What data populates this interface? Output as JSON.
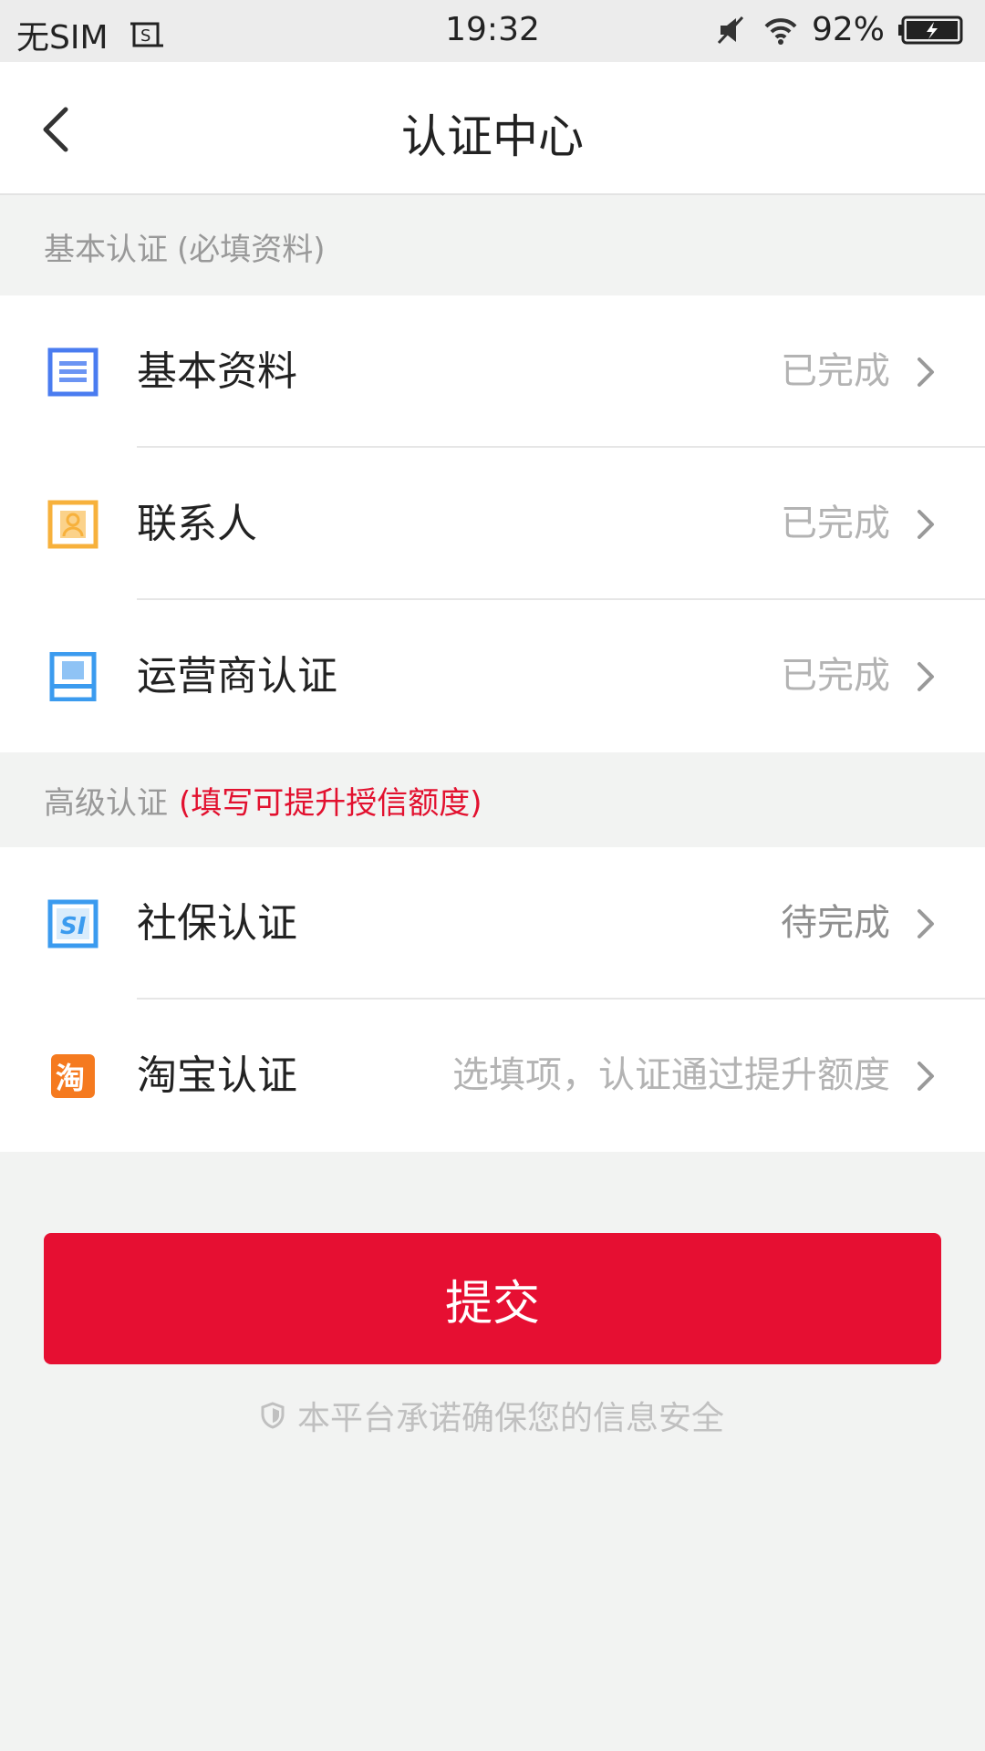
{
  "status_bar": {
    "carrier": "无SIM",
    "time": "19:32",
    "battery": "92%"
  },
  "header": {
    "title": "认证中心"
  },
  "basic_section": {
    "title": "基本认证",
    "note": "(必填资料)",
    "items": [
      {
        "label": "基本资料",
        "status": "已完成",
        "icon": "document-icon",
        "color": "#4a7cf0"
      },
      {
        "label": "联系人",
        "status": "已完成",
        "icon": "contact-card-icon",
        "color": "#f7b13c"
      },
      {
        "label": "运营商认证",
        "status": "已完成",
        "icon": "phone-icon",
        "color": "#3b9bef"
      }
    ]
  },
  "advanced_section": {
    "title": "高级认证",
    "note": "(填写可提升授信额度)",
    "note_color": "#e2112f",
    "items": [
      {
        "label": "社保认证",
        "status": "待完成",
        "icon": "social-insurance-icon",
        "color": "#3b9bef"
      },
      {
        "label": "淘宝认证",
        "status": "选填项，认证通过提升额度",
        "icon": "taobao-icon",
        "color": "#f57a1f"
      }
    ]
  },
  "submit": {
    "label": "提交",
    "color": "#e60f32"
  },
  "security_note": "本平台承诺确保您的信息安全"
}
